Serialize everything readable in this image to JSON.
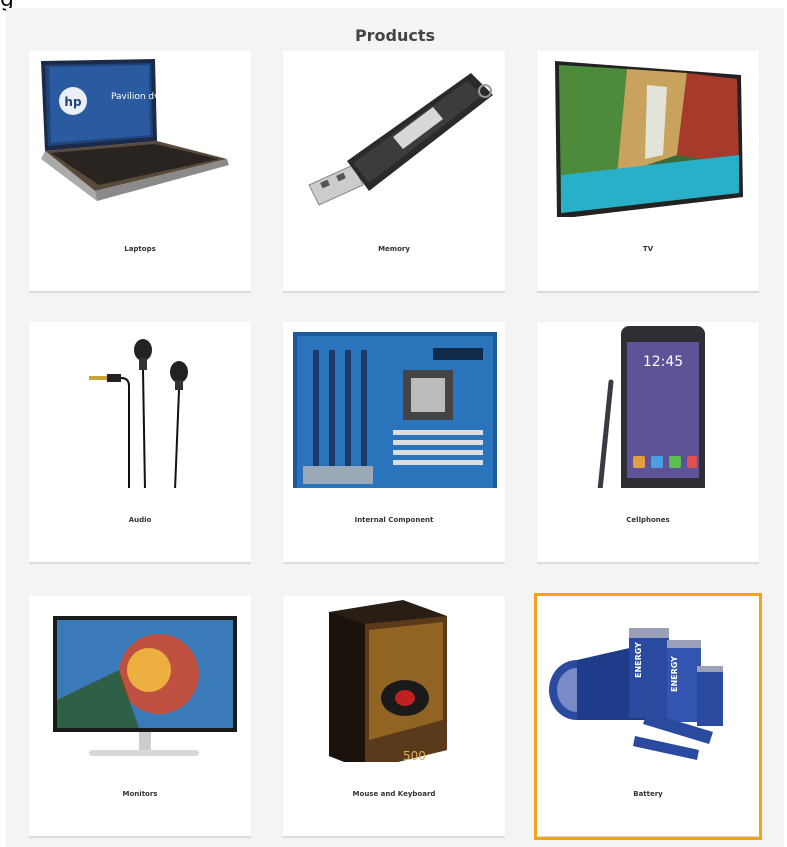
{
  "edge_text": "g",
  "page": {
    "title": "Products"
  },
  "accent": "#f4a11b",
  "products": [
    {
      "label": "Laptops",
      "icon": "laptop-icon"
    },
    {
      "label": "Memory",
      "icon": "usb-drive-icon"
    },
    {
      "label": "TV",
      "icon": "tv-icon"
    },
    {
      "label": "Audio",
      "icon": "earphones-icon"
    },
    {
      "label": "Internal Component",
      "icon": "motherboard-icon"
    },
    {
      "label": "Cellphones",
      "icon": "smartphone-icon"
    },
    {
      "label": "Monitors",
      "icon": "monitor-icon"
    },
    {
      "label": "Mouse and Keyboard",
      "icon": "mouse-box-icon"
    },
    {
      "label": "Battery",
      "icon": "battery-icon",
      "selected": true
    }
  ]
}
